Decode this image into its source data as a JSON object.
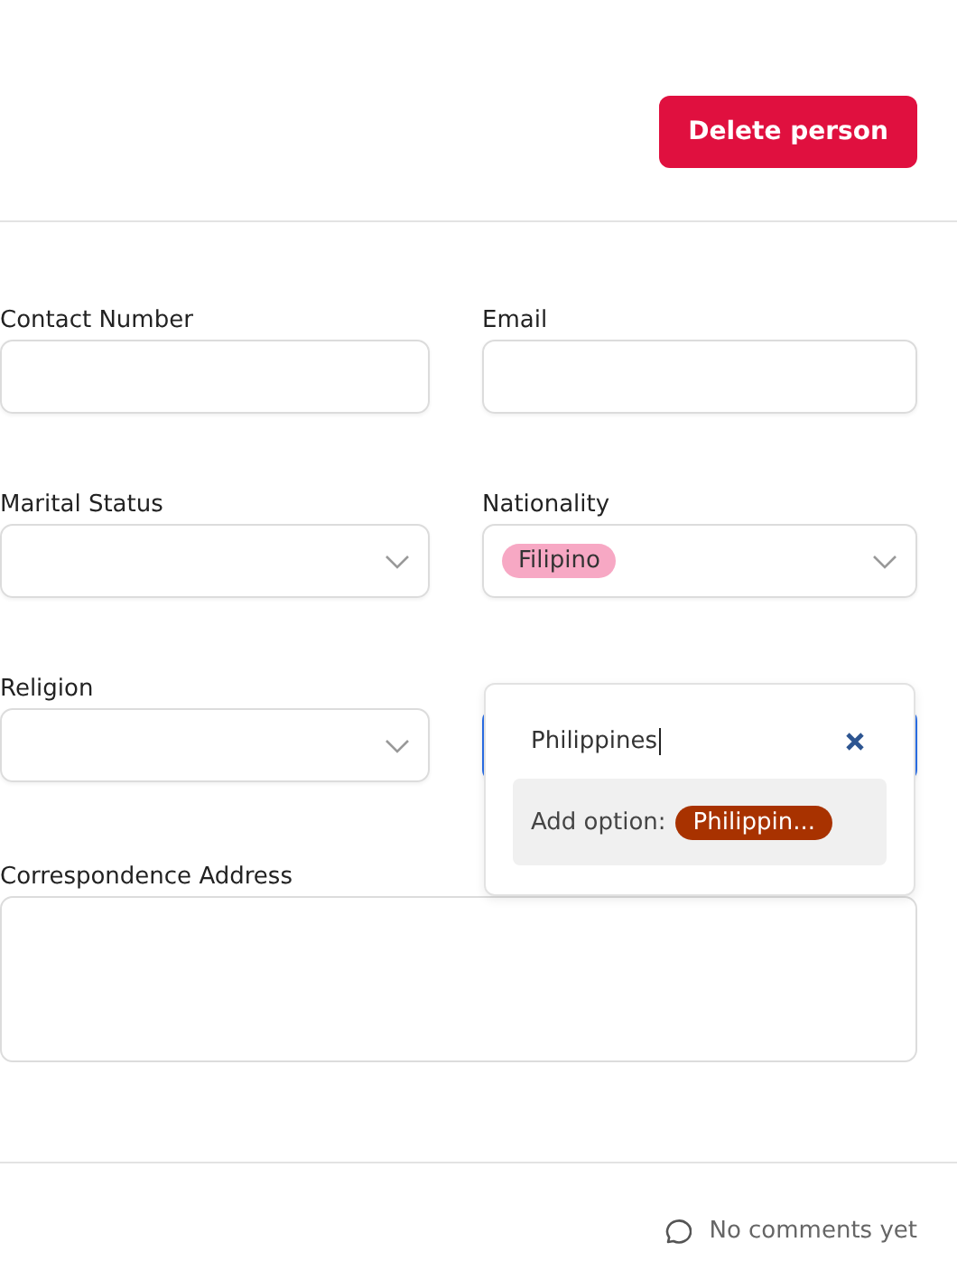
{
  "header": {
    "delete_button": "Delete person"
  },
  "fields": [
    {
      "label": "Contact Number",
      "kind": "text",
      "focused": false
    },
    {
      "label": "Email",
      "kind": "text",
      "focused": false
    },
    {
      "label": "Marital Status",
      "kind": "select",
      "focused": false
    },
    {
      "label": "Nationality",
      "kind": "select",
      "tags": [
        {
          "text": "Filipino",
          "color": "#f7a8c4"
        }
      ],
      "focused": false
    },
    {
      "label": "Religion",
      "kind": "select",
      "focused": false
    },
    {
      "kind": "select",
      "focused": true,
      "popup": {
        "search": "Philippines",
        "add_label": "Add option:",
        "new_tag": {
          "text": "Philippin...",
          "color": "#a83200"
        }
      }
    }
  ],
  "address": {
    "label": "Correspondence Address"
  },
  "comments": {
    "text": "No comments yet"
  }
}
